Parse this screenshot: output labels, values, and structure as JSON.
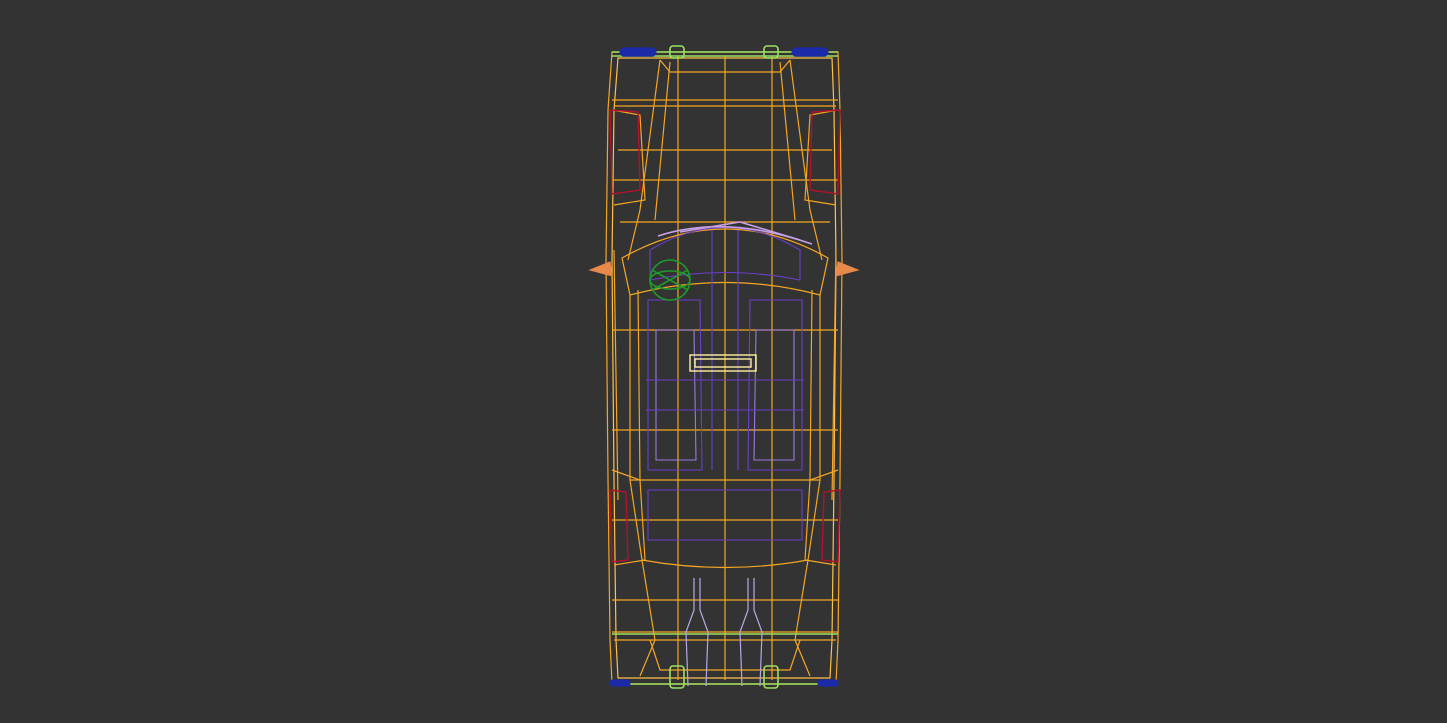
{
  "viewport": {
    "view": "top",
    "render_mode": "wireframe",
    "subject": "car-model",
    "background_color": "#333333"
  },
  "colors": {
    "body_wire": "#f5a623",
    "body_wire_light": "#ffc04a",
    "interior_wire": "#6a3fc8",
    "interior_wire_light": "#9a7ae0",
    "glass_wire": "#c8a0e8",
    "lights_wire": "#b0122a",
    "bumper_wire": "#9be060",
    "wheel_cap": "#1b2aa8",
    "helper_gizmo": "#1f9a2a",
    "exhaust_wire": "#b8a8e8",
    "mirror": "#e8894a",
    "badge": "#fff2a0"
  },
  "icons": {
    "gizmo": "orbit-gizmo-icon"
  }
}
